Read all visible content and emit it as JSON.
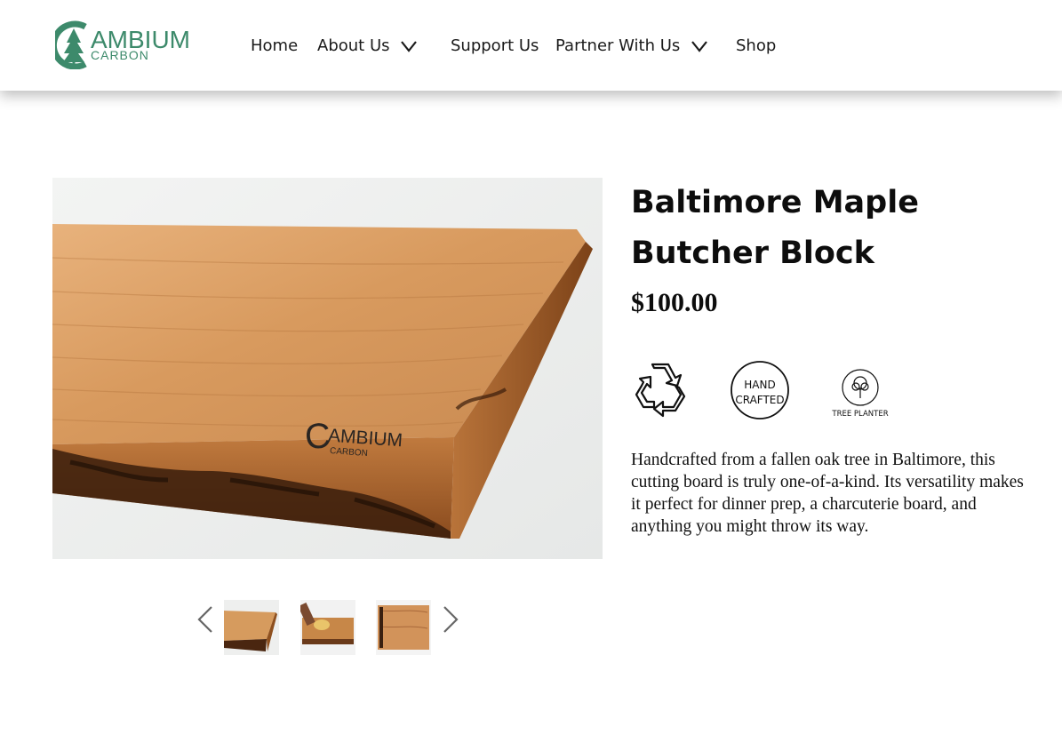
{
  "brand": {
    "name_primary": "AMBIUM",
    "name_secondary": "CARBON",
    "logo_initial": "C",
    "color": "#3d8a6b"
  },
  "nav": {
    "items": [
      {
        "label": "Home",
        "has_dropdown": false
      },
      {
        "label": "About Us",
        "has_dropdown": true
      },
      {
        "label": "Support Us",
        "has_dropdown": false
      },
      {
        "label": "Partner With Us",
        "has_dropdown": true
      },
      {
        "label": "Shop",
        "has_dropdown": false
      }
    ]
  },
  "product": {
    "title": "Baltimore Maple Butcher Block",
    "price": "$100.00",
    "image_stamp": {
      "initial": "C",
      "primary": "AMBIUM",
      "secondary": "CARBON"
    },
    "badges": [
      {
        "icon": "recycle-icon"
      },
      {
        "icon": "handcrafted-badge-icon",
        "line1": "HAND",
        "line2": "CRAFTED"
      },
      {
        "icon": "tree-planter-icon",
        "label": "TREE PLANTER"
      }
    ],
    "description": "Handcrafted from a fallen oak tree in Baltimore, this cutting board is truly one-of-a-kind. Its versatility makes it perfect for dinner prep, a charcuterie board, and anything you might throw its way.",
    "gallery": {
      "thumbnails": [
        "board-angled-thumb",
        "board-cutting-thumb",
        "board-topdown-thumb"
      ],
      "prev_icon": "chevron-left-icon",
      "next_icon": "chevron-right-icon"
    }
  },
  "colors": {
    "wood_light": "#e0a771",
    "wood_mid": "#c9874e",
    "wood_dark": "#3a1d0c",
    "text": "#111111"
  }
}
